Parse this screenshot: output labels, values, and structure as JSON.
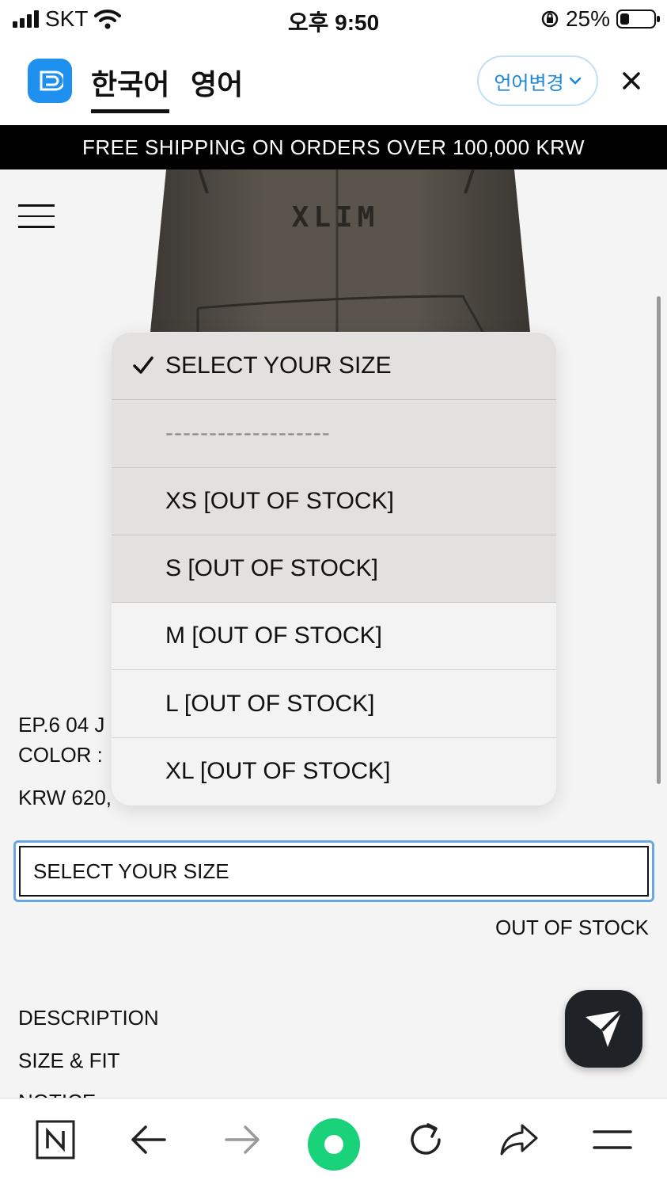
{
  "status_bar": {
    "carrier": "SKT",
    "time": "오후 9:50",
    "battery": "25%",
    "battery_level": 0.25
  },
  "translation_bar": {
    "source_lang": "한국어",
    "target_lang": "영어",
    "change_lang_label": "언어변경"
  },
  "banner": {
    "text": "FREE SHIPPING ON ORDERS OVER 100,000 KRW"
  },
  "product": {
    "image_text": "XLIM",
    "name": "EP.6 04 J",
    "color_label": "COLOR :",
    "price": "KRW 620,"
  },
  "size_select": {
    "value": "SELECT YOUR SIZE",
    "stock_status": "OUT OF STOCK",
    "options": [
      "SELECT YOUR SIZE",
      "-------------------",
      "XS [OUT OF STOCK]",
      "S [OUT OF STOCK]",
      "M [OUT OF STOCK]",
      "L [OUT OF STOCK]",
      "XL [OUT OF STOCK]"
    ]
  },
  "sections": {
    "description": "DESCRIPTION",
    "size_fit": "SIZE & FIT",
    "notice": "NOTICE"
  },
  "colors": {
    "accent_blue": "#1e90f0",
    "banner_bg": "#000000",
    "green_home": "#19d27a"
  }
}
